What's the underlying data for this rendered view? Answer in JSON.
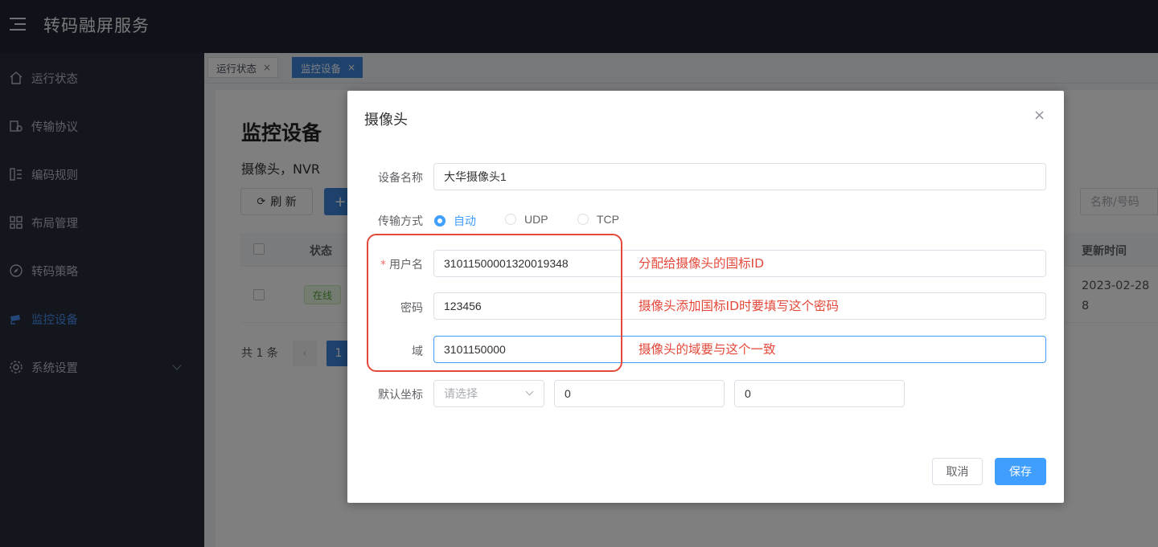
{
  "header": {
    "title": "转码融屏服务",
    "menu_icon": "menu-icon"
  },
  "sidebar": {
    "items": [
      {
        "label": "运行状态",
        "icon": "home-icon"
      },
      {
        "label": "传输协议",
        "icon": "transfer-icon"
      },
      {
        "label": "编码规则",
        "icon": "list-icon"
      },
      {
        "label": "布局管理",
        "icon": "grid-icon"
      },
      {
        "label": "转码策略",
        "icon": "compass-icon"
      },
      {
        "label": "监控设备",
        "icon": "camera-icon",
        "active": true
      },
      {
        "label": "系统设置",
        "icon": "gear-icon"
      }
    ]
  },
  "tabs": [
    {
      "label": "运行状态",
      "close": "×"
    },
    {
      "label": "监控设备",
      "close": "×",
      "active": true
    }
  ],
  "main": {
    "title": "监控设备",
    "subtitle": "摄像头，NVR",
    "refresh_label": "刷 新",
    "add_label": "+",
    "search_placeholder": "名称/号码",
    "table": {
      "columns": {
        "status": "状态",
        "updated": "更新时间"
      },
      "rows": [
        {
          "status": "在线",
          "updated": "2023-02-28 8"
        }
      ]
    },
    "pagination": {
      "total": "共 1 条",
      "prev": "‹",
      "current": "1"
    }
  },
  "dialog": {
    "title": "摄像头",
    "close": "×",
    "fields": {
      "device_name": {
        "label": "设备名称",
        "value": "大华摄像头1"
      },
      "transport": {
        "label": "传输方式",
        "options": [
          "自动",
          "UDP",
          "TCP"
        ],
        "selected": "自动"
      },
      "username": {
        "label": "用户名",
        "required_mark": "*",
        "value": "31011500001320019348"
      },
      "password": {
        "label": "密码",
        "value": "123456"
      },
      "domain": {
        "label": "域",
        "value": "3101150000"
      },
      "default_coord": {
        "label": "默认坐标",
        "select_placeholder": "请选择",
        "x": "0",
        "y": "0"
      }
    },
    "annotations": {
      "username": "分配给摄像头的国标ID",
      "password": "摄像头添加国标ID时要填写这个密码",
      "domain": "摄像头的域要与这个一致"
    },
    "buttons": {
      "cancel": "取消",
      "save": "保存"
    }
  },
  "colors": {
    "primary": "#409eff",
    "annotation": "#e3483a",
    "sidebar_bg": "#272d39",
    "header_bg": "#1e2430"
  }
}
